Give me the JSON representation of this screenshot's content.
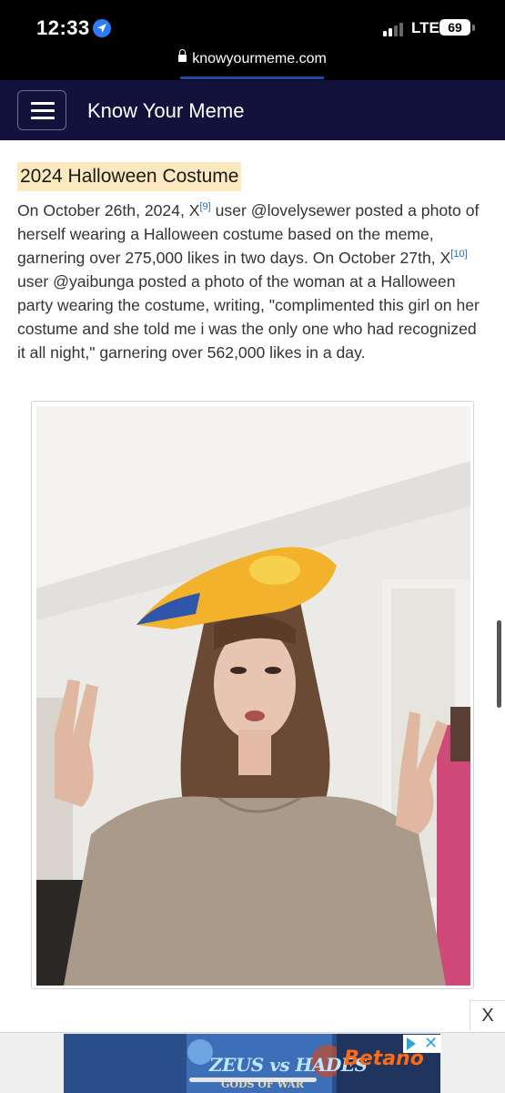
{
  "status_bar": {
    "time": "12:33",
    "network": "LTE",
    "battery": "69"
  },
  "browser": {
    "url": "knowyourmeme.com"
  },
  "site": {
    "title": "Know Your Meme"
  },
  "article": {
    "section_title": "2024 Halloween Costume",
    "paragraph": {
      "part1": "On October 26th, 2024, X",
      "ref1": "[9]",
      "part2": " user @lovelysewer posted a photo of herself wearing a Halloween costume based on the meme, garnering over 275,000 likes in two days. On October 27th, X",
      "ref2": "[10]",
      "part3": " user @yaibunga posted a photo of the woman at a Halloween party wearing the costume, writing, \"complimented this girl on her costume and she told me i was the only one who had recognized it all night,\" garnering over 562,000 likes in a day."
    }
  },
  "ad": {
    "close_label": "X",
    "brand": "Betano",
    "game_title": "ZEUS vs HADES",
    "game_subtitle": "GODS OF WAR"
  },
  "colors": {
    "header_bg": "#13123c",
    "section_highlight": "#fde9c0",
    "link": "#2a6bc0",
    "ad_brand": "#ff6a13"
  }
}
